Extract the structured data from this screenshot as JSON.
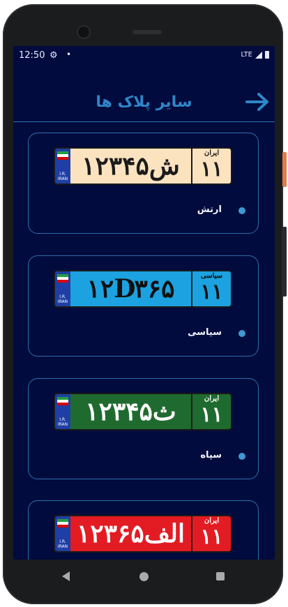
{
  "status": {
    "time": "12:50",
    "network": "LTE"
  },
  "header": {
    "title": "سایر پلاک ها"
  },
  "cards": [
    {
      "label": "ارتش",
      "plate_text": "۱۲ش۳۴۵",
      "side_top": "ایران",
      "side_num": "۱۱",
      "bg": "#fbe3c0",
      "fg": "#1b1b1b"
    },
    {
      "label": "سیاسی",
      "plate_text": "۱۲D۳۶۵",
      "side_top": "سیاسی",
      "side_num": "۱۱",
      "bg": "#1ca2e0",
      "fg": "#101010"
    },
    {
      "label": "سپاه",
      "plate_text": "۱۲ث۳۴۵",
      "side_top": "ایران",
      "side_num": "۱۱",
      "bg": "#1f6b2f",
      "fg": "#ffffff"
    },
    {
      "label": "",
      "plate_text": "۱۲الف۳۶۵",
      "side_top": "ایران",
      "side_num": "۱۱",
      "bg": "#e31b23",
      "fg": "#ffffff"
    }
  ],
  "plate_flag": {
    "line1": "I.R.",
    "line2": "IRAN"
  },
  "icons": {
    "back": "arrow-right-icon",
    "settings": "gear-icon"
  },
  "colors": {
    "background": "#020b3d",
    "accent": "#2f86c7",
    "bullet": "#3d98d4"
  }
}
